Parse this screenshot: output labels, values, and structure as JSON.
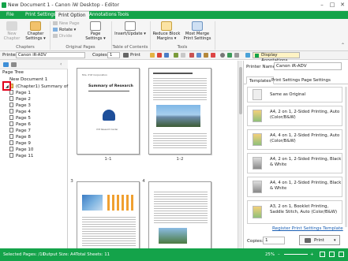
{
  "window": {
    "title": "New Document 1 - Canon iW Desktop - Editor"
  },
  "ribbon_tabs": [
    "File",
    "Print Settings",
    "Print Option",
    "Annotations",
    "Tools"
  ],
  "ribbon": {
    "new_chapter": "New Chapter",
    "chapter_settings": "Chapter Settings",
    "chapters_group": "Chapters",
    "new_page": "New Page",
    "rotate": "Rotate",
    "divide": "Divide",
    "page_settings": "Page Settings",
    "original_pages_group": "Original Pages",
    "insert_update": "Insert/Update",
    "toc_group": "Table of Contents",
    "reduce_block_margins": "Reduce Block Margins",
    "most_merge_print_settings": "Most Merge Print Settings",
    "tools_group": "Tools"
  },
  "toolbar": {
    "printer_label": "Printer",
    "printer_value": "Canon iR-ADV",
    "copies_label": "Copies",
    "copies_value": "1",
    "print_label": "Print",
    "display_annotations": "Display Annotations"
  },
  "tree": {
    "title": "Page Tree",
    "root": "New Document 1",
    "chapter": "(Chapter1) Summary of R",
    "pages": [
      "Page 1",
      "Page 2",
      "Page 3",
      "Page 4",
      "Page 5",
      "Page 6",
      "Page 7",
      "Page 8",
      "Page 9",
      "Page 10",
      "Page 11"
    ]
  },
  "pages_view": {
    "labels": [
      "1-1",
      "1-2",
      "3",
      "4"
    ],
    "page1": {
      "company": "Mrs. XYZ Corporation",
      "title": "Summary of Research",
      "sub": "XYZ Research Center"
    }
  },
  "right_panel": {
    "printer_name_label": "Printer Name:",
    "printer_name_value": "Canon iR-ADV",
    "tabs": [
      "Templates",
      "Print Settings",
      "Page Settings"
    ],
    "templates": [
      "Same as Original",
      "A4, 2 on 1, 2-Sided Printing, Auto (Color/B&W)",
      "A4, 4 on 1, 2-Sided Printing, Auto (Color/B&W)",
      "A4, 2 on 1, 2-Sided Printing, Black & White",
      "A4, 4 on 1, 2-Sided Printing, Black & White",
      "A3, 2 on 1, Booklet Printing, Saddle Stitch, Auto (Color/B&W)"
    ],
    "register_link": "Register Print Settings Template",
    "copies_label": "Copies:",
    "copies_value": "1",
    "print_button": "Print"
  },
  "status": {
    "selected_pages": "Selected Pages: /11",
    "output_size": "Output Size: A4",
    "total_sheets": "Total Sheets: 11",
    "zoom": "25%"
  },
  "colors": {
    "accent": "#14a34a",
    "highlight": "#e0001b"
  }
}
